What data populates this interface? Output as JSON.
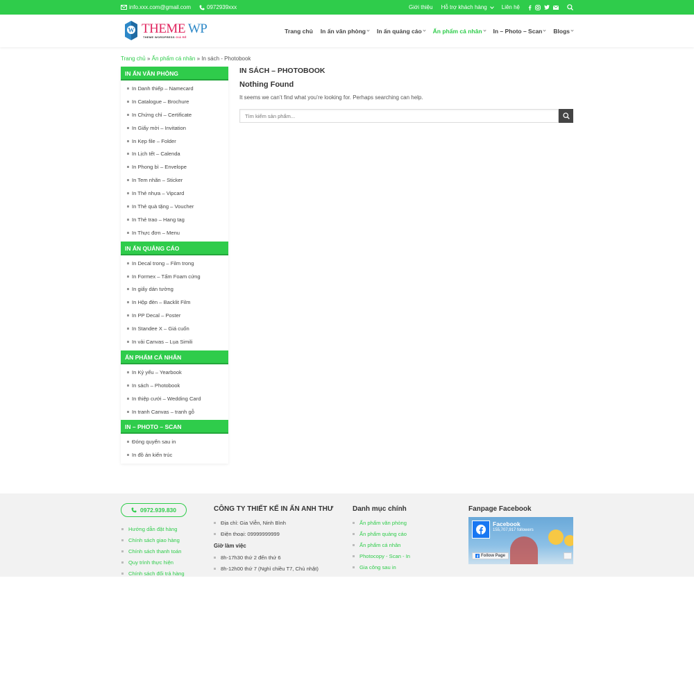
{
  "topbar": {
    "email": "info.xxx.com@gmail.com",
    "phone": "0972939xxx",
    "links": [
      "Giới thiệu",
      "Hỗ trợ khách hàng",
      "Liên hệ"
    ]
  },
  "logo": {
    "main_left": "THEME ",
    "main_right": "WP",
    "sub_left": "THEME WORDPRESS ",
    "sub_right": "GIÁ RẺ"
  },
  "nav": {
    "items": [
      "Trang chủ",
      "In ấn văn phòng",
      "In ấn quảng cáo",
      "Ấn phẩm cá nhân",
      "In – Photo – Scan",
      "Blogs"
    ]
  },
  "breadcrumb": {
    "home": "Trang chủ",
    "sep": " » ",
    "parent": "Ấn phẩm cá nhân",
    "current": "In sách - Photobook"
  },
  "sidebar": {
    "blocks": [
      {
        "title": "IN ẤN VĂN PHÒNG",
        "items": [
          "In Danh thiếp – Namecard",
          "In Catalogue – Brochure",
          "In Chứng chỉ – Certificate",
          "In Giấy mời – Invitation",
          "In Kẹp file – Folder",
          "In Lịch tết – Calenda",
          "In Phong bì – Envelope",
          "In Tem nhãn – Sticker",
          "In Thẻ nhựa – Vipcard",
          "In Thẻ quà tặng – Voucher",
          "In Thẻ trao – Hang tag",
          "In Thực đơn – Menu"
        ]
      },
      {
        "title": "IN ẤN QUẢNG CÁO",
        "items": [
          "In Decal trong – Film trong",
          "In Formex – Tấm Foam cứng",
          "In giấy dán tường",
          "In Hộp đèn – Backlit Film",
          "In PP Decal – Poster",
          "In Standee X – Giá cuốn",
          "In vải Canvas – Lụa Simili"
        ]
      },
      {
        "title": "ẤN PHẨM CÁ NHÂN",
        "items": [
          "In Kỷ yếu – Yearbook",
          "In sách – Photobook",
          "In thiệp cưới – Wedding Card",
          "In tranh Canvas – tranh gỗ"
        ]
      },
      {
        "title": "IN – PHOTO – SCAN",
        "items": [
          "Đóng quyển sau in",
          "In đồ án kiến trúc"
        ]
      }
    ]
  },
  "main": {
    "title": "IN SÁCH – PHOTOBOOK",
    "nf_title": "Nothing Found",
    "nf_text": "It seems we can’t find what you’re looking for. Perhaps searching can help.",
    "search_placeholder": "Tìm kiếm sản phẩm..."
  },
  "footer": {
    "phone": "0972.939.830",
    "links": [
      "Hướng dẫn đặt hàng",
      "Chính sách giao hàng",
      "Chính sách thanh toán",
      "Quy trình thực hiện",
      "Chính sách đổi trả hàng"
    ],
    "company_title": "CÔNG TY THIẾT KẾ IN ẤN ANH THƯ",
    "address": "Địa chỉ: Gia Viễn, Ninh Bình",
    "tel": "Điện thoại: 09999999999",
    "hours_title": "Giờ làm việc",
    "hours": [
      "8h-17h30 thứ 2 đến thứ 6",
      "8h-12h00 thứ 7 (Nghỉ chiều T7, Chủ nhật)"
    ],
    "cats_title": "Danh mục chính",
    "cats": [
      "Ấn phẩm văn phòng",
      "Ấn phẩm quảng cáo",
      "Ấn phẩm cá nhân",
      "Photocopy - Scan - In",
      "Gia công sau in"
    ],
    "fanpage_title": "Fanpage Facebook",
    "fb_name": "Facebook",
    "fb_followers": "155,707,917 followers",
    "fb_follow": "Follow Page"
  },
  "colors": {
    "accent": "#2fcc4b",
    "dark": "#444444"
  }
}
